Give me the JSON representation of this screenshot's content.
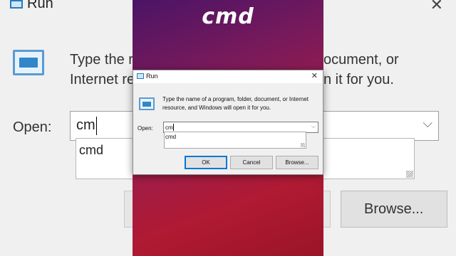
{
  "overlay": {
    "text": "cmd"
  },
  "background": {
    "title": "Run",
    "close": "✕",
    "desc_left": "Type the r\nInternet re",
    "desc_right": "ocument, or\nn it for you.",
    "open_label": "Open:",
    "input_value": "cm",
    "dropdown_item": "cmd",
    "browse_label": "Browse...",
    "chevron": "⌵"
  },
  "dialog": {
    "title": "Run",
    "close": "✕",
    "description": "Type the name of a program, folder, document, or Internet resource, and Windows will open it for you.",
    "open_label": "Open:",
    "input_value": "cm",
    "chevron": "⌵",
    "autocomplete": [
      "cmd"
    ],
    "buttons": {
      "ok": "OK",
      "cancel": "Cancel",
      "browse": "Browse..."
    }
  }
}
